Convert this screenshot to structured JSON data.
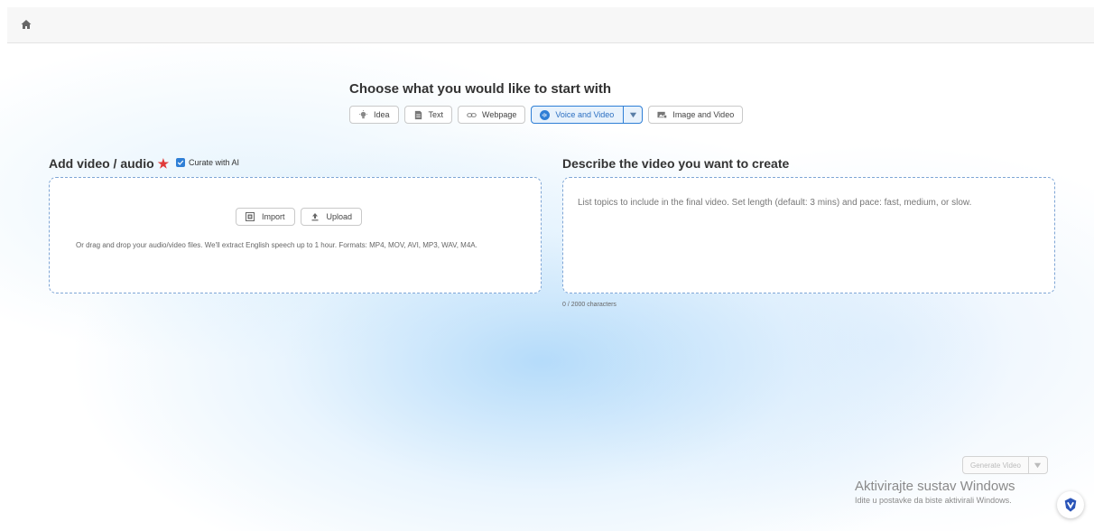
{
  "header": {
    "home_icon": "home-icon"
  },
  "chooser": {
    "heading": "Choose what you would like to start with",
    "tabs": [
      {
        "label": "Idea",
        "icon": "lightbulb-icon"
      },
      {
        "label": "Text",
        "icon": "document-icon"
      },
      {
        "label": "Webpage",
        "icon": "link-icon"
      },
      {
        "label": "Voice and Video",
        "icon": "audio-wave-icon",
        "active": true
      },
      {
        "label": "Image and Video",
        "icon": "image-icon"
      }
    ]
  },
  "upload": {
    "title": "Add video / audio",
    "required_mark": "★",
    "curate_label": "Curate with AI",
    "curate_checked": true,
    "import_label": "Import",
    "upload_label": "Upload",
    "hint": "Or drag and drop your audio/video files. We'll extract English speech up to 1 hour. Formats: MP4, MOV, AVI, MP3, WAV, M4A."
  },
  "describe": {
    "title": "Describe the video you want to create",
    "placeholder": "List topics to include in the final video. Set length (default: 3 mins) and pace: fast, medium, or slow.",
    "char_count": "0 / 2000 characters"
  },
  "generate": {
    "label": "Generate Video"
  },
  "watermark": {
    "title": "Aktivirajte sustav Windows",
    "subtitle": "Idite u postavke da biste aktivirali Windows."
  },
  "colors": {
    "accent": "#2f7fd6",
    "required": "#e03a3a"
  }
}
